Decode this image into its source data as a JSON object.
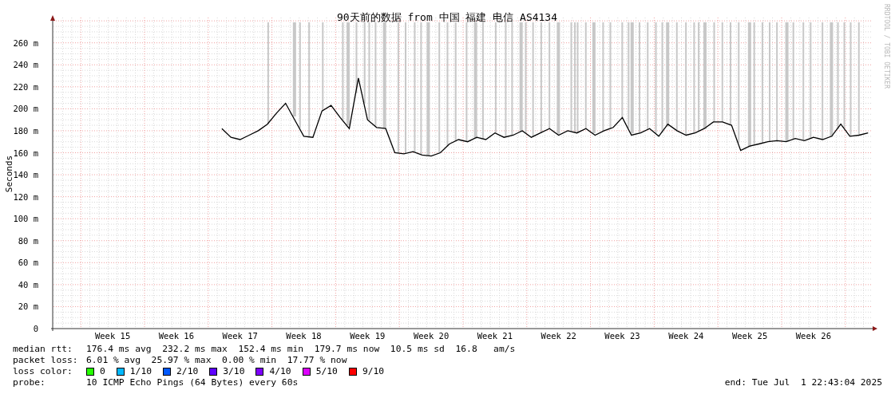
{
  "graph": {
    "credit": "RRDTOOL / TOBI OETIKER",
    "chart_data": {
      "type": "line",
      "title": "90天前的数据 from 中国 福建 电信 AS4134",
      "ylabel": "Seconds",
      "grid": true,
      "ylim": [
        0,
        283
      ],
      "yticks": [
        {
          "value": 0,
          "label": "0"
        },
        {
          "value": 20,
          "label": "20 m"
        },
        {
          "value": 40,
          "label": "40 m"
        },
        {
          "value": 60,
          "label": "60 m"
        },
        {
          "value": 80,
          "label": "80 m"
        },
        {
          "value": 100,
          "label": "100 m"
        },
        {
          "value": 120,
          "label": "120 m"
        },
        {
          "value": 140,
          "label": "140 m"
        },
        {
          "value": 160,
          "label": "160 m"
        },
        {
          "value": 180,
          "label": "180 m"
        },
        {
          "value": 200,
          "label": "200 m"
        },
        {
          "value": 220,
          "label": "220 m"
        },
        {
          "value": 240,
          "label": "240 m"
        },
        {
          "value": 260,
          "label": "260 m"
        }
      ],
      "categories": [
        null,
        null,
        null,
        null,
        null,
        null,
        "Week 15",
        null,
        null,
        null,
        null,
        null,
        null,
        "Week 16",
        null,
        null,
        null,
        null,
        null,
        null,
        "Week 17",
        null,
        null,
        null,
        null,
        null,
        null,
        "Week 18",
        null,
        null,
        null,
        null,
        null,
        null,
        "Week 19",
        null,
        null,
        null,
        null,
        null,
        null,
        "Week 20",
        null,
        null,
        null,
        null,
        null,
        null,
        "Week 21",
        null,
        null,
        null,
        null,
        null,
        null,
        "Week 22",
        null,
        null,
        null,
        null,
        null,
        null,
        "Week 23",
        null,
        null,
        null,
        null,
        null,
        null,
        "Week 24",
        null,
        null,
        null,
        null,
        null,
        null,
        "Week 25",
        null,
        null,
        null,
        null,
        null,
        null,
        "Week 26",
        null,
        null,
        null,
        null,
        null,
        null
      ],
      "series": [
        {
          "color": "#000000",
          "values": [
            null,
            null,
            null,
            null,
            null,
            null,
            null,
            null,
            null,
            null,
            null,
            null,
            null,
            null,
            null,
            null,
            null,
            null,
            182,
            174,
            172,
            176,
            180,
            186,
            196,
            205,
            190,
            175,
            174,
            198,
            203,
            192,
            182,
            228,
            190,
            183,
            182,
            160,
            159,
            161,
            158,
            157,
            160,
            168,
            172,
            170,
            174,
            172,
            178,
            174,
            176,
            180,
            174,
            178,
            182,
            176,
            180,
            178,
            182,
            176,
            180,
            183,
            192,
            176,
            178,
            182,
            175,
            186,
            180,
            176,
            178,
            182,
            188,
            188,
            185,
            162,
            166,
            168,
            170,
            171,
            170,
            173,
            171,
            174,
            172,
            175,
            186,
            175,
            176,
            178
          ]
        }
      ]
    }
  },
  "legend": [
    {
      "kind": "text",
      "label": "median rtt:",
      "text": "176.4 ms avg  232.2 ms max  152.4 ms min  179.7 ms now  10.5 ms sd  16.8   am/s"
    },
    {
      "kind": "text",
      "label": "packet loss:",
      "text": "6.01 % avg  25.97 % max  0.00 % min  17.77 % now"
    },
    {
      "kind": "colors",
      "label": "loss color:",
      "items": [
        {
          "label": "0",
          "color": "#26ff00"
        },
        {
          "label": "1/10",
          "color": "#00b8ff"
        },
        {
          "label": "2/10",
          "color": "#0059ff"
        },
        {
          "label": "3/10",
          "color": "#5e00ff"
        },
        {
          "label": "4/10",
          "color": "#7e00ff"
        },
        {
          "label": "5/10",
          "color": "#dd00ff"
        },
        {
          "label": "9/10",
          "color": "#ff0000"
        }
      ]
    },
    {
      "kind": "probe",
      "label": "probe:",
      "text": "10 ICMP Echo Pings (64 Bytes) every 60s",
      "end": "end: Tue Jul  1 22:43:04 2025"
    }
  ]
}
